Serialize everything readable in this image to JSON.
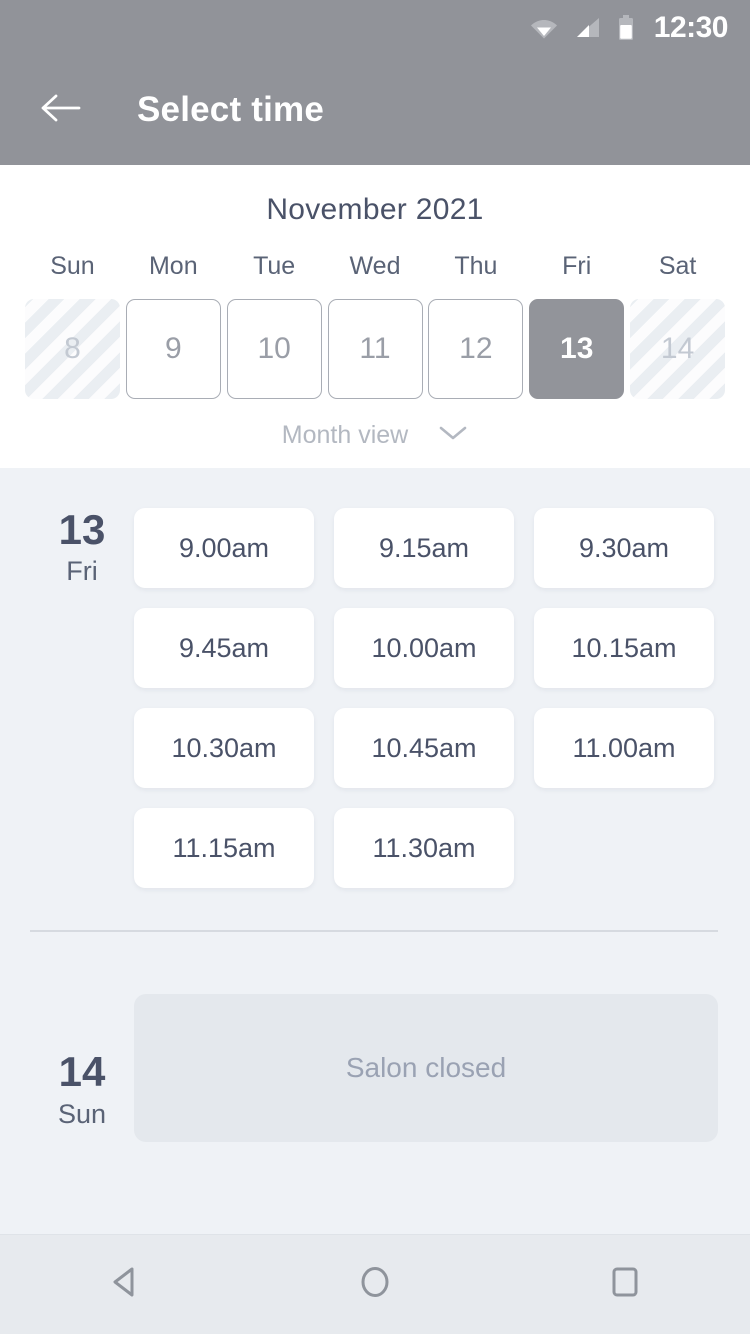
{
  "status_bar": {
    "time": "12:30",
    "icons": [
      "wifi-icon",
      "cell-signal-icon",
      "battery-icon"
    ]
  },
  "app_bar": {
    "back_icon": "arrow-left-icon",
    "title": "Select time"
  },
  "calendar": {
    "month_title": "November 2021",
    "weekdays": [
      "Sun",
      "Mon",
      "Tue",
      "Wed",
      "Thu",
      "Fri",
      "Sat"
    ],
    "dates": [
      {
        "label": "8",
        "state": "disabled"
      },
      {
        "label": "9",
        "state": "available"
      },
      {
        "label": "10",
        "state": "available"
      },
      {
        "label": "11",
        "state": "available"
      },
      {
        "label": "12",
        "state": "available"
      },
      {
        "label": "13",
        "state": "selected"
      },
      {
        "label": "14",
        "state": "disabled"
      }
    ],
    "view_toggle": {
      "label": "Month view",
      "icon": "chevron-down-icon"
    }
  },
  "day_groups": [
    {
      "day_number": "13",
      "weekday": "Fri",
      "slots": [
        "9.00am",
        "9.15am",
        "9.30am",
        "9.45am",
        "10.00am",
        "10.15am",
        "10.30am",
        "10.45am",
        "11.00am",
        "11.15am",
        "11.30am"
      ]
    },
    {
      "day_number": "14",
      "weekday": "Sun",
      "closed_message": "Salon closed"
    }
  ],
  "nav_bar": {
    "back_label": "back-triangle-icon",
    "home_label": "home-circle-icon",
    "recents_label": "recents-square-icon"
  },
  "colors": {
    "header_gray": "#919399",
    "page_background": "#eff2f6",
    "panel_white": "#ffffff",
    "text_slate": "#4a5268",
    "muted_text": "#9aa2b3",
    "selected_date": "#92949a",
    "closed_block": "#e4e8ed",
    "nav_bar": "#e7eaee"
  }
}
